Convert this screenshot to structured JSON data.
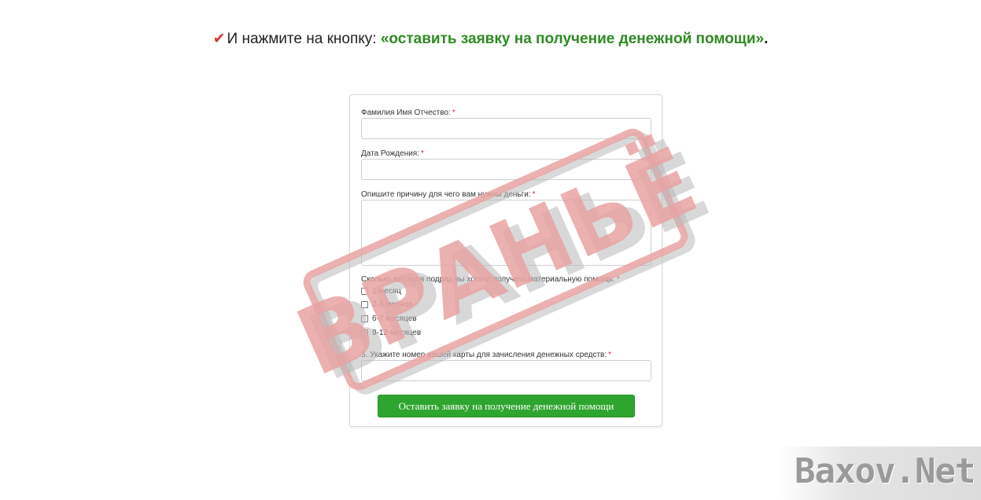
{
  "instruction": {
    "check_icon": "check-icon",
    "prefix": "И нажмите на кнопку: ",
    "highlight": "«оставить заявку на получение денежной помощи»",
    "suffix": ".",
    "check_color": "#d23a3a",
    "highlight_color": "#2e8b23"
  },
  "form": {
    "required_mark": "*",
    "full_name": {
      "label": "Фамилия Имя Отчество:",
      "value": ""
    },
    "birth_date": {
      "label": "Дата Рождения:",
      "value": ""
    },
    "reason": {
      "label": "Опишите причину для чего вам нужны деньги:",
      "value": ""
    },
    "months": {
      "label": "Сколько месяцев подряд вы хотите получать материальную помощь:",
      "options": [
        "1 месяц",
        "2-3 месяца",
        "6-7 месяцев",
        "9-12 месяцев"
      ],
      "checked": [
        false,
        false,
        false,
        false
      ]
    },
    "card": {
      "label": "5. Укажите номер вашей карты для зачисления денежных средств:",
      "value": ""
    },
    "submit_label": "Оставить заявку на получение денежной помощи",
    "submit_color": "#2ea52e"
  },
  "stamp": {
    "text": "ВРАНЬЁ",
    "color": "#e8a3a3"
  },
  "watermark": {
    "text": "Baxov.Net"
  }
}
